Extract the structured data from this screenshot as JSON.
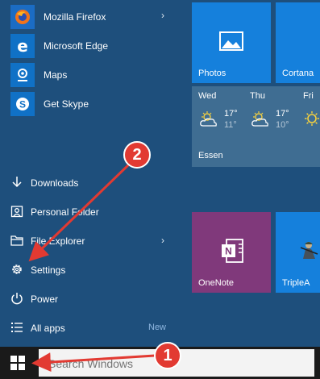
{
  "app_list": [
    {
      "label": "Mozilla Firefox",
      "has_chevron": true
    },
    {
      "label": "Microsoft Edge",
      "has_chevron": false
    },
    {
      "label": "Maps",
      "has_chevron": false
    },
    {
      "label": "Get Skype",
      "has_chevron": false
    }
  ],
  "places": {
    "downloads": "Downloads",
    "personal_folder": "Personal Folder",
    "file_explorer": "File Explorer",
    "settings": "Settings",
    "power": "Power",
    "all_apps": "All apps",
    "new_badge": "New"
  },
  "tiles": {
    "photos": "Photos",
    "cortana": "Cortana",
    "onenote": "OneNote",
    "triplea": "TripleA"
  },
  "weather": {
    "location": "Essen",
    "days": [
      {
        "name": "Wed",
        "high": "17°",
        "low": "11°"
      },
      {
        "name": "Thu",
        "high": "17°",
        "low": "10°"
      },
      {
        "name": "Fri",
        "high": "",
        "low": ""
      }
    ]
  },
  "taskbar": {
    "search_placeholder": "Search Windows"
  },
  "annotations": {
    "badge_1": "1",
    "badge_2": "2"
  },
  "colors": {
    "menu_bg": "#1e4f7c",
    "tile_blue": "#1580dc",
    "onenote_purple": "#80397b",
    "badge_red": "#e23a32"
  }
}
